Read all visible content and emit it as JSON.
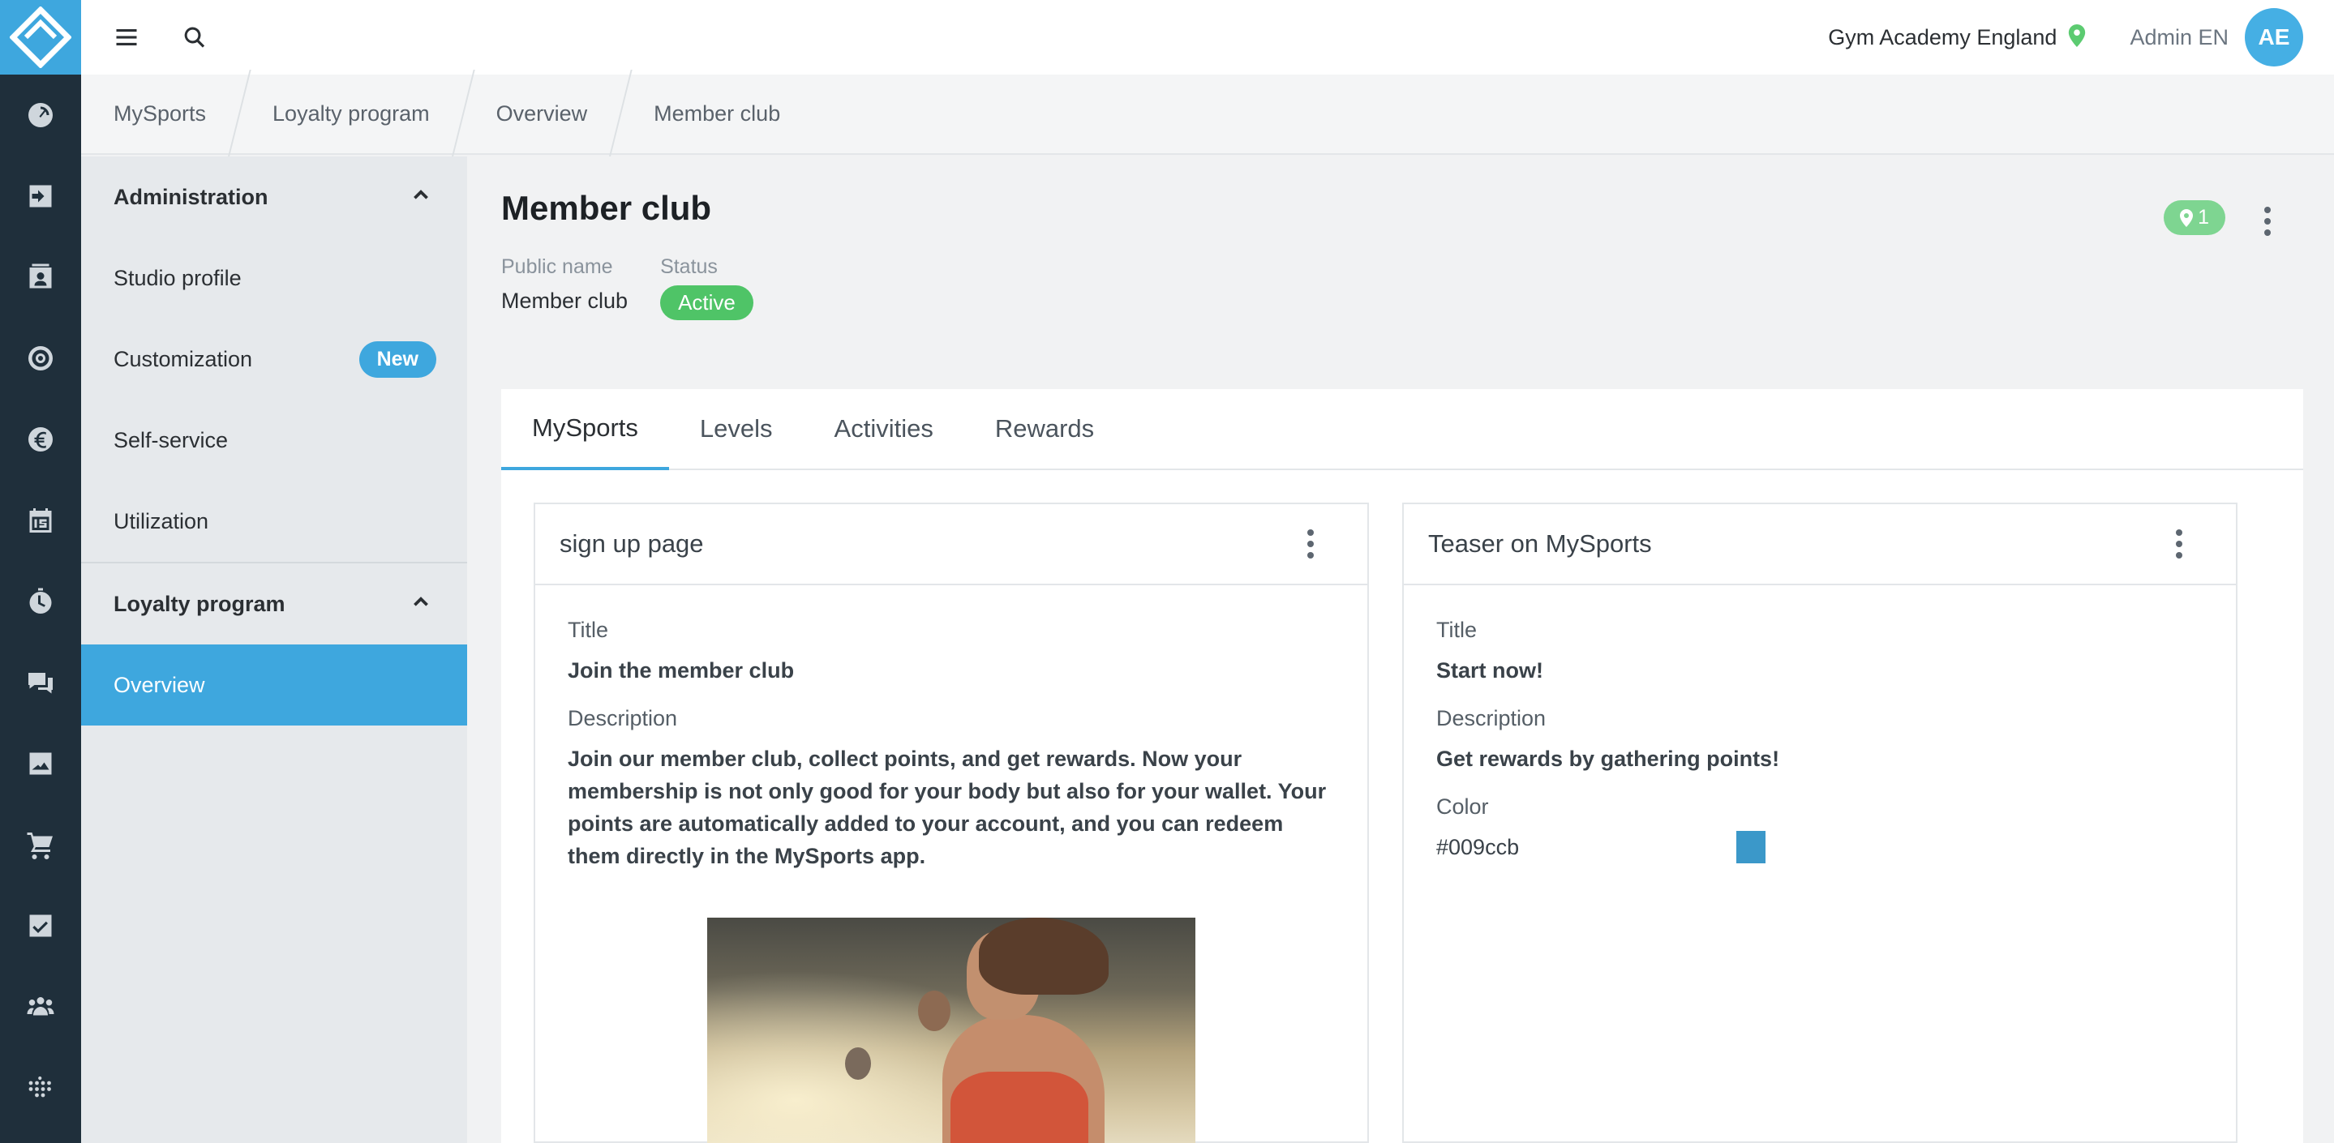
{
  "topbar": {
    "studio_name": "Gym Academy England",
    "user_name": "Admin EN",
    "avatar_initials": "AE"
  },
  "rail": {
    "icons": [
      "dashboard-icon",
      "check-in-icon",
      "contacts-icon",
      "target-icon",
      "euro-icon",
      "calendar-icon",
      "stopwatch-icon",
      "chat-icon",
      "image-icon",
      "cart-icon",
      "checkbox-icon",
      "members-icon",
      "more-apps-icon"
    ]
  },
  "breadcrumb": [
    "MySports",
    "Loyalty program",
    "Overview",
    "Member club"
  ],
  "sidenav": {
    "administration": {
      "label": "Administration",
      "items": [
        "Studio profile",
        "Customization",
        "Self-service",
        "Utilization"
      ],
      "new_badge": "New"
    },
    "loyalty": {
      "label": "Loyalty program",
      "items": [
        "Overview"
      ]
    }
  },
  "page": {
    "title": "Member club",
    "public_name_label": "Public name",
    "public_name": "Member club",
    "status_label": "Status",
    "status": "Active",
    "locations_count": "1",
    "status_color": "#4fc467"
  },
  "tabs": [
    "MySports",
    "Levels",
    "Activities",
    "Rewards"
  ],
  "active_tab": "MySports",
  "cards": {
    "signup": {
      "title": "sign up page",
      "title_label": "Title",
      "title_value": "Join the member club",
      "description_label": "Description",
      "description_value": "Join our member club, collect points, and get rewards. Now your membership is not only good for your body but also for your wallet. Your points are automatically added to your account, and you can redeem them directly in the MySports app."
    },
    "teaser": {
      "title": "Teaser on MySports",
      "title_label": "Title",
      "title_value": "Start now!",
      "description_label": "Description",
      "description_value": "Get rewards by gathering points!",
      "color_label": "Color",
      "color_value": "#009ccb"
    }
  },
  "colors": {
    "accent": "#3ea7de",
    "rail": "#1f2f3b",
    "active_status": "#4fc467"
  }
}
